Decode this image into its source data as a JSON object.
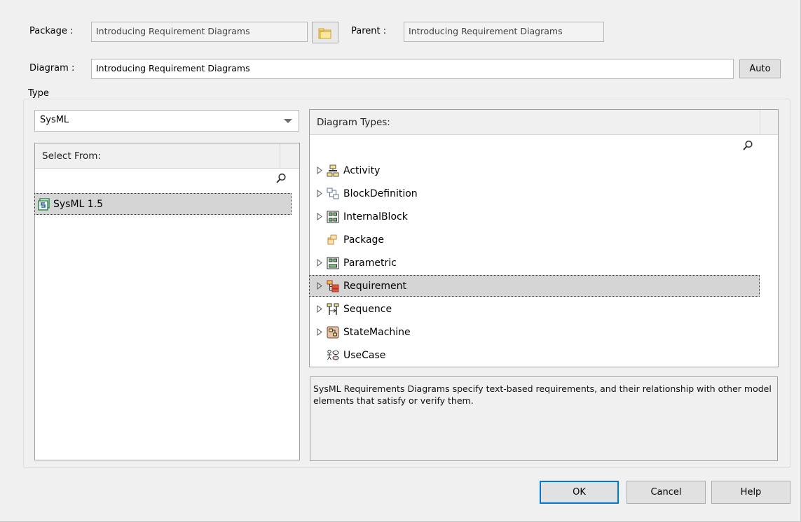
{
  "package": {
    "label": "Package :",
    "value": "Introducing Requirement Diagrams"
  },
  "parent": {
    "label": "Parent :",
    "value": "Introducing Requirement Diagrams"
  },
  "diagram": {
    "label": "Diagram :",
    "value": "Introducing Requirement Diagrams",
    "auto_label": "Auto"
  },
  "type_group": {
    "title": "Type"
  },
  "type_combo": {
    "selected": "SysML"
  },
  "select_from": {
    "header": "Select From:",
    "items": [
      {
        "label": "SysML 1.5",
        "selected": true
      }
    ]
  },
  "diagram_types": {
    "header": "Diagram Types:",
    "items": [
      {
        "label": "Activity",
        "icon": "activity-diagram-icon",
        "expandable": true
      },
      {
        "label": "BlockDefinition",
        "icon": "block-definition-icon",
        "expandable": true
      },
      {
        "label": "InternalBlock",
        "icon": "internal-block-icon",
        "expandable": true
      },
      {
        "label": "Package",
        "icon": "package-icon",
        "expandable": false
      },
      {
        "label": "Parametric",
        "icon": "parametric-icon",
        "expandable": true
      },
      {
        "label": "Requirement",
        "icon": "requirement-icon",
        "expandable": true,
        "selected": true
      },
      {
        "label": "Sequence",
        "icon": "sequence-icon",
        "expandable": true
      },
      {
        "label": "StateMachine",
        "icon": "state-machine-icon",
        "expandable": true
      },
      {
        "label": "UseCase",
        "icon": "use-case-icon",
        "expandable": false
      }
    ]
  },
  "description": "SysML Requirements Diagrams specify text-based requirements, and their relationship with other model elements that satisfy or verify them.",
  "buttons": {
    "ok": "OK",
    "cancel": "Cancel",
    "help": "Help"
  },
  "colors": {
    "selection": "#d5d5d5",
    "default_button_border": "#0078d7",
    "dialog_bg": "#f0f0f0"
  }
}
